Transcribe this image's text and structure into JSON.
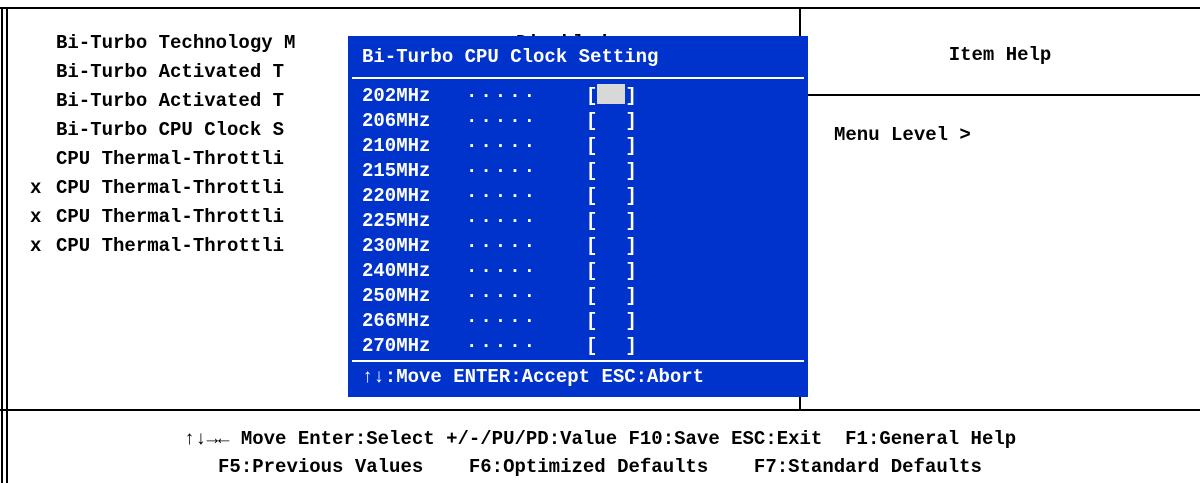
{
  "settings": [
    {
      "marker": " ",
      "label": "Bi-Turbo Technology M",
      "value": "Disabled"
    },
    {
      "marker": " ",
      "label": "Bi-Turbo Activated T",
      "value": ""
    },
    {
      "marker": " ",
      "label": "Bi-Turbo Activated T",
      "value": ""
    },
    {
      "marker": " ",
      "label": "Bi-Turbo CPU Clock S",
      "value": ""
    },
    {
      "marker": " ",
      "label": "CPU Thermal-Throttli",
      "value": ""
    },
    {
      "marker": "x",
      "label": "CPU Thermal-Throttli",
      "value": ""
    },
    {
      "marker": "x",
      "label": "CPU Thermal-Throttli",
      "value": ""
    },
    {
      "marker": "x",
      "label": "CPU Thermal-Throttli",
      "value": ""
    }
  ],
  "help": {
    "title": "Item Help",
    "body": "Menu Level >"
  },
  "popup": {
    "title": "Bi-Turbo CPU Clock Setting",
    "dots": "·····",
    "bracket_open": "[",
    "bracket_close": "]",
    "options": [
      {
        "label": "202MHz",
        "selected": true
      },
      {
        "label": "206MHz",
        "selected": false
      },
      {
        "label": "210MHz",
        "selected": false
      },
      {
        "label": "215MHz",
        "selected": false
      },
      {
        "label": "220MHz",
        "selected": false
      },
      {
        "label": "225MHz",
        "selected": false
      },
      {
        "label": "230MHz",
        "selected": false
      },
      {
        "label": "240MHz",
        "selected": false
      },
      {
        "label": "250MHz",
        "selected": false
      },
      {
        "label": "266MHz",
        "selected": false
      },
      {
        "label": "270MHz",
        "selected": false
      }
    ],
    "footer": "↑↓:Move ENTER:Accept ESC:Abort"
  },
  "footer": {
    "line1": "↑↓→← Move Enter:Select +/-/PU/PD:Value F10:Save ESC:Exit  F1:General Help",
    "line2": "F5:Previous Values    F6:Optimized Defaults    F7:Standard Defaults"
  },
  "colors": {
    "popup_bg": "#0033cc",
    "popup_text": "#ffffff",
    "selection": "#d8d8d8"
  }
}
